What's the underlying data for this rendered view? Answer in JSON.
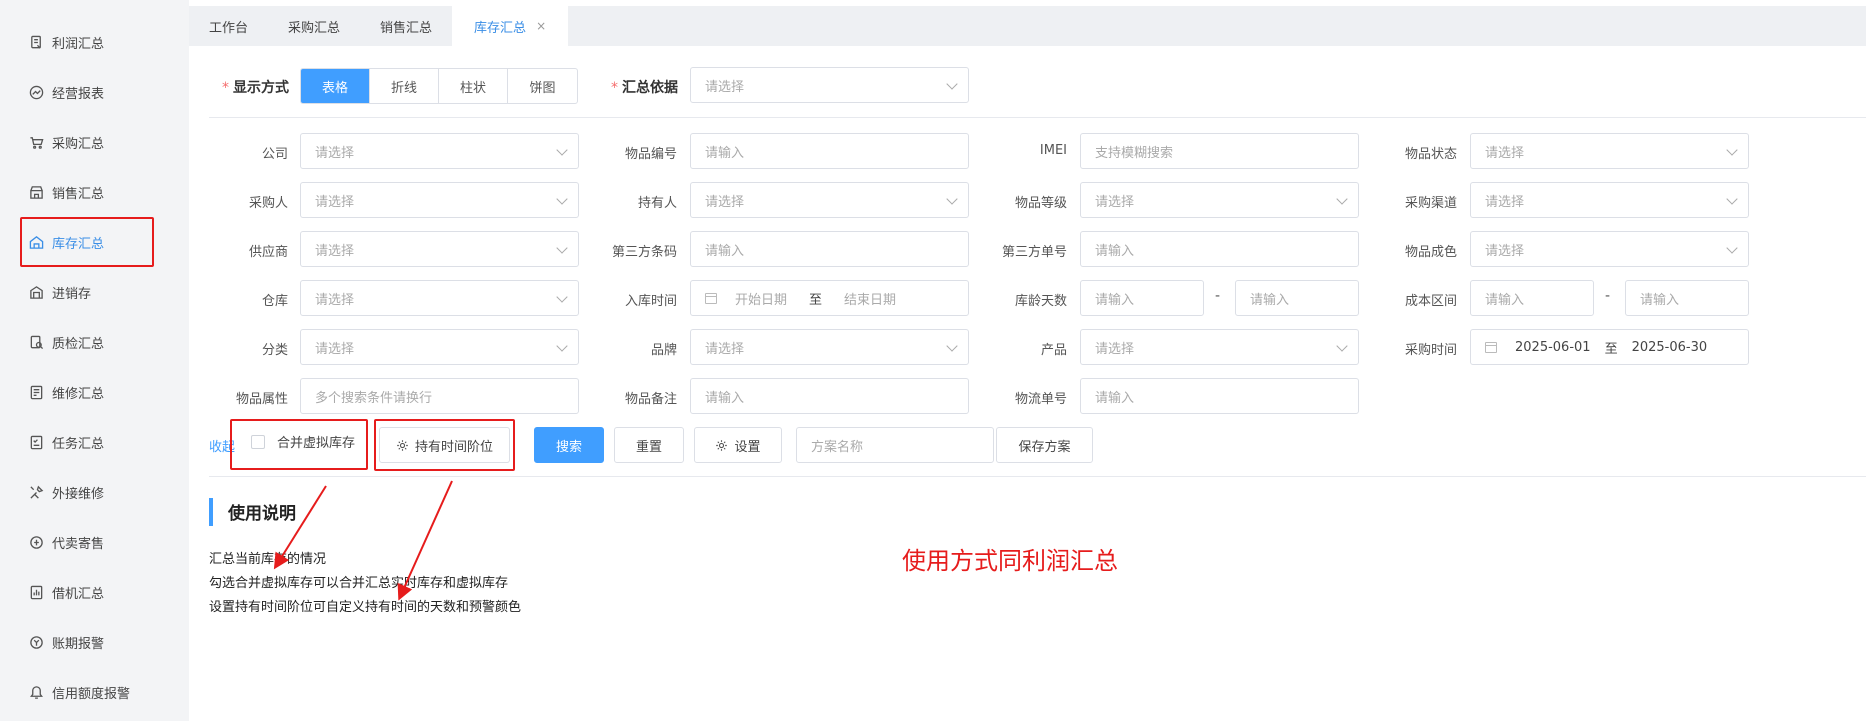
{
  "sidebar": {
    "items": [
      {
        "label": "利润汇总",
        "icon": "report-icon"
      },
      {
        "label": "经营报表",
        "icon": "chart-line-icon"
      },
      {
        "label": "采购汇总",
        "icon": "cart-icon"
      },
      {
        "label": "销售汇总",
        "icon": "shop-icon"
      },
      {
        "label": "库存汇总",
        "icon": "warehouse-icon"
      },
      {
        "label": "进销存",
        "icon": "building-icon"
      },
      {
        "label": "质检汇总",
        "icon": "inspect-icon"
      },
      {
        "label": "维修汇总",
        "icon": "repair-icon"
      },
      {
        "label": "任务汇总",
        "icon": "task-icon"
      },
      {
        "label": "外接维修",
        "icon": "tools-icon"
      },
      {
        "label": "代卖寄售",
        "icon": "consign-icon"
      },
      {
        "label": "借机汇总",
        "icon": "bar-chart-icon"
      },
      {
        "label": "账期报警",
        "icon": "alarm-icon"
      },
      {
        "label": "信用额度报警",
        "icon": "credit-icon"
      }
    ]
  },
  "tabs": [
    {
      "label": "工作台"
    },
    {
      "label": "采购汇总"
    },
    {
      "label": "销售汇总"
    },
    {
      "label": "库存汇总",
      "close": "×"
    }
  ],
  "display": {
    "req": "*",
    "label": "显示方式",
    "options": [
      "表格",
      "折线",
      "柱状",
      "饼图"
    ],
    "basis_label": "汇总依据",
    "basis_placeholder": "请选择"
  },
  "fields": {
    "company": {
      "label": "公司",
      "placeholder": "请选择"
    },
    "item_no": {
      "label": "物品编号",
      "placeholder": "请输入"
    },
    "imei": {
      "label": "IMEI",
      "placeholder": "支持模糊搜索"
    },
    "item_status": {
      "label": "物品状态",
      "placeholder": "请选择"
    },
    "buyer": {
      "label": "采购人",
      "placeholder": "请选择"
    },
    "holder": {
      "label": "持有人",
      "placeholder": "请选择"
    },
    "grade": {
      "label": "物品等级",
      "placeholder": "请选择"
    },
    "channel": {
      "label": "采购渠道",
      "placeholder": "请选择"
    },
    "supplier": {
      "label": "供应商",
      "placeholder": "请选择"
    },
    "third_code": {
      "label": "第三方条码",
      "placeholder": "请输入"
    },
    "third_order": {
      "label": "第三方单号",
      "placeholder": "请输入"
    },
    "color": {
      "label": "物品成色",
      "placeholder": "请选择"
    },
    "warehouse": {
      "label": "仓库",
      "placeholder": "请选择"
    },
    "in_time": {
      "label": "入库时间",
      "start": "开始日期",
      "sep": "至",
      "end": "结束日期"
    },
    "age_days": {
      "label": "库龄天数",
      "min": "请输入",
      "dash": "-",
      "max": "请输入"
    },
    "cost_range": {
      "label": "成本区间",
      "min": "请输入",
      "dash": "-",
      "max": "请输入"
    },
    "category": {
      "label": "分类",
      "placeholder": "请选择"
    },
    "brand": {
      "label": "品牌",
      "placeholder": "请选择"
    },
    "product": {
      "label": "产品",
      "placeholder": "请选择"
    },
    "buy_time": {
      "label": "采购时间",
      "start": "2025-06-01",
      "sep": "至",
      "end": "2025-06-30"
    },
    "attr": {
      "label": "物品属性",
      "placeholder": "多个搜索条件请换行"
    },
    "remark": {
      "label": "物品备注",
      "placeholder": "请输入"
    },
    "logistics": {
      "label": "物流单号",
      "placeholder": "请输入"
    }
  },
  "controls": {
    "collapse": "收起",
    "merge_virtual": "合并虚拟库存",
    "hold_time_tiers": "持有时间阶位",
    "search": "搜索",
    "reset": "重置",
    "settings": "设置",
    "scheme_placeholder": "方案名称",
    "save_scheme": "保存方案"
  },
  "instructions": {
    "title": "使用说明",
    "lines": [
      "汇总当前库存的情况",
      "勾选合并虚拟库存可以合并汇总实时库存和虚拟库存",
      "设置持有时间阶位可自定义持有时间的天数和预警颜色"
    ],
    "note": "使用方式同利润汇总"
  },
  "colors": {
    "primary": "#409eff",
    "annotation": "#e61c1c"
  }
}
